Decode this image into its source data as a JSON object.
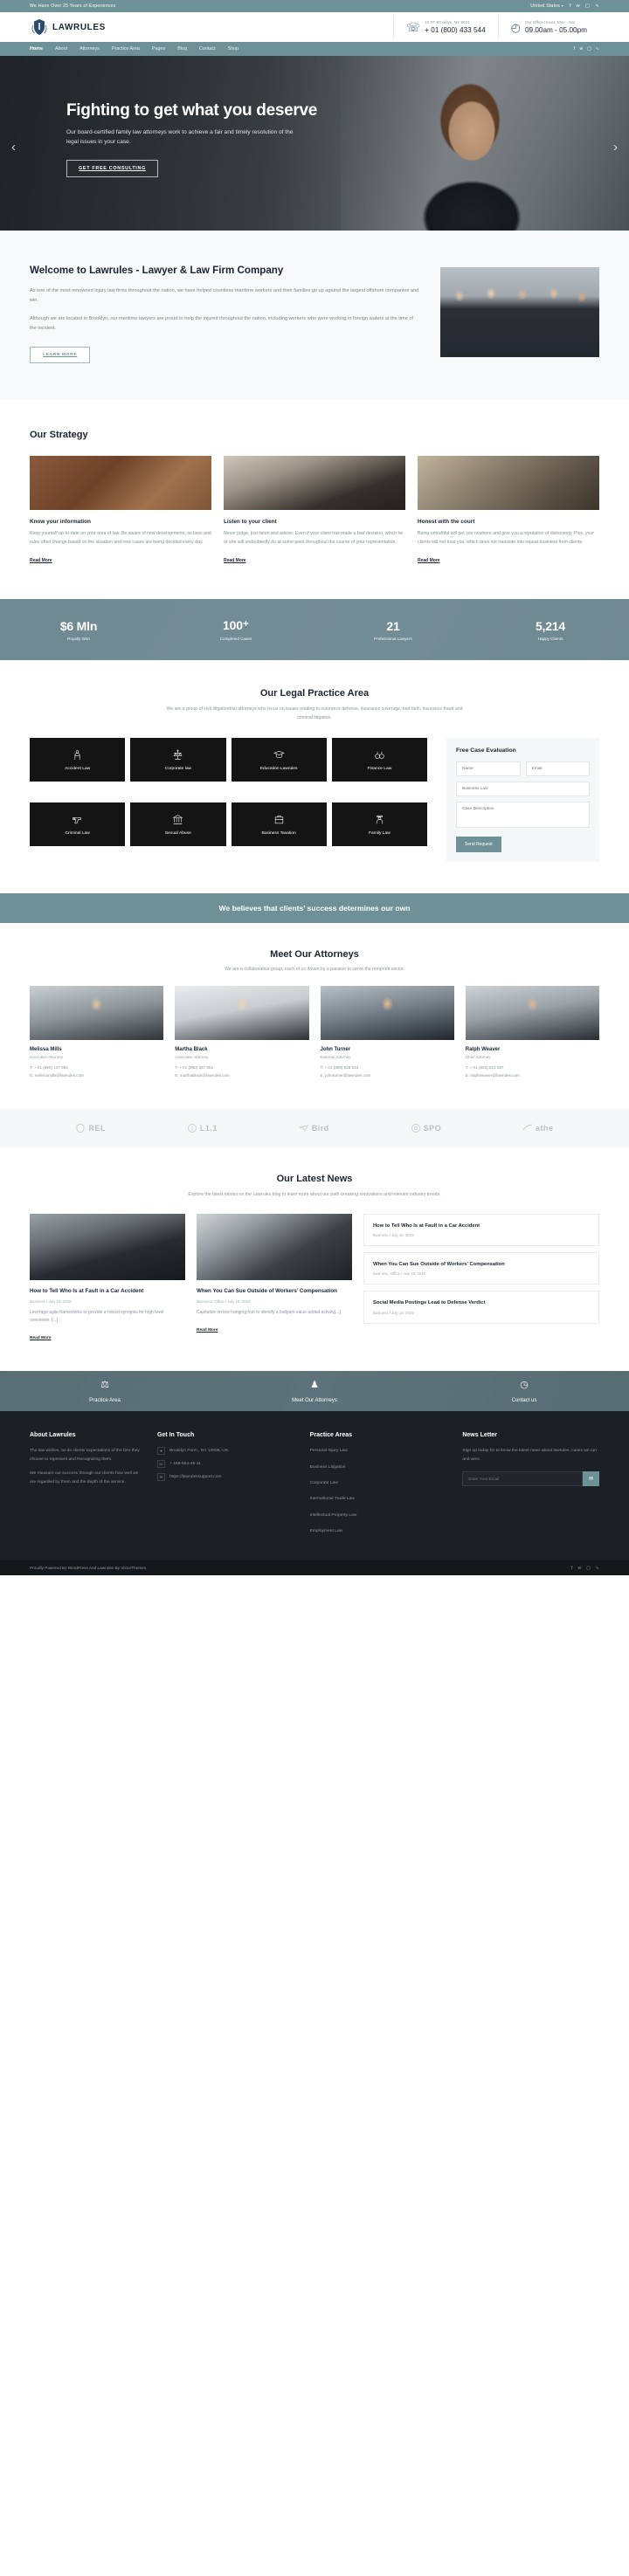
{
  "topbar": {
    "tagline": "We Have Over 25 Years of Experiences",
    "country": "United States",
    "socials": [
      "facebook-icon",
      "twitter-icon",
      "instagram-icon",
      "rss-icon"
    ]
  },
  "header": {
    "brand": "LAWRULES",
    "contact": {
      "label": "10 FF Brooklyn, NY 8021",
      "value": "+ 01 (800) 433 544"
    },
    "hours": {
      "label": "Our Office Hours: Mon - Sat",
      "value": "09.00am - 05.00pm"
    }
  },
  "nav": {
    "items": [
      {
        "label": "Home",
        "active": true
      },
      {
        "label": "About",
        "active": false
      },
      {
        "label": "Attorneys",
        "active": false
      },
      {
        "label": "Practice Area",
        "active": false
      },
      {
        "label": "Pages",
        "active": false
      },
      {
        "label": "Blog",
        "active": false
      },
      {
        "label": "Contact",
        "active": false
      },
      {
        "label": "Shop",
        "active": false
      }
    ]
  },
  "hero": {
    "title": "Fighting to get what you deserve",
    "subtitle": "Our board-certified family law attorneys work to achieve a fair and timely resolution of the legal issues in your case.",
    "cta": "GET FREE CONSULTING",
    "prev": "‹",
    "next": "›"
  },
  "welcome": {
    "title": "Welcome to Lawrules - Lawyer & Law Firm Company",
    "p1": "As one of the most renowned injury law firms throughout the nation, we have helped countless maritime workers and their families go up against the largest offshore companies and win.",
    "p2": "Although we are located in Brooklyn, our maritime lawyers are proud to help the injured throughout the nation, including workers who were working in foreign waters at the time of the incident.",
    "cta": "LEARN MORE"
  },
  "strategy": {
    "title": "Our Strategy",
    "cards": [
      {
        "title": "Know your information",
        "body": "Keep yourself up-to-date on your area of law. Be aware of new developments, as laws and rules often change based on the situation and new cases are being decided every day.",
        "link": "Read More"
      },
      {
        "title": "Listen to your client",
        "body": "Never judge, just listen and advise. Even if your client has made a bad decision, which he or she will undoubtedly do at some point throughout the course of your representation.",
        "link": "Read More"
      },
      {
        "title": "Honest with the court",
        "body": "Being untruthful will get you nowhere and give you a reputation of dishonesty. Plus, your clients will not trust you, which does not translate into repeat business from clients.",
        "link": "Read More"
      }
    ]
  },
  "counters": [
    {
      "value": "$6 Mln",
      "label": "Royalty Won"
    },
    {
      "value": "100⁺",
      "label": "Completed Cases"
    },
    {
      "value": "21",
      "label": "Professional Lawyers"
    },
    {
      "value": "5,214",
      "label": "Happy Clients"
    }
  ],
  "practice": {
    "title": "Our Legal Practice Area",
    "subtitle": "We are a group of civil litigationtrial attorneys who focus on issues relating to insurance defense, insurance coverage, bad faith, insurance fraud and criminal litigation.",
    "tiles": [
      {
        "label": "Accident Law",
        "icon": "injured-person-icon"
      },
      {
        "label": "Corporate law",
        "icon": "scales-icon"
      },
      {
        "label": "Education Lawrules",
        "icon": "graduation-cap-icon"
      },
      {
        "label": "Finance Law",
        "icon": "handcuffs-icon"
      },
      {
        "label": "Criminal Law",
        "icon": "gun-icon"
      },
      {
        "label": "Sexual Abuse",
        "icon": "courthouse-icon"
      },
      {
        "label": "Business Taxation",
        "icon": "briefcase-icon"
      },
      {
        "label": "Family Law",
        "icon": "police-officer-icon"
      }
    ],
    "form": {
      "title": "Free Case Evaluation",
      "name_placeholder": "Name",
      "email_placeholder": "Email",
      "subject_placeholder": "Business Law",
      "description_placeholder": "Case Description",
      "submit": "Send Request"
    }
  },
  "banner": {
    "text": "We believes that clients’ success determines our own"
  },
  "attorneys": {
    "title": "Meet Our Attorneys",
    "subtitle": "We are a collaborative group, each of us driven by a passion to serve the nonprofit sector.",
    "members": [
      {
        "name": "Melissa Mills",
        "role": "Executive Attorney",
        "phone": "T: + 01 (890) 147 856",
        "email": "E: melissamills@lawrules.com"
      },
      {
        "name": "Martha Black",
        "role": "Associate Attorney",
        "phone": "T: + 01 (890) 357 951",
        "email": "E: marthaBlack@lawrules.com"
      },
      {
        "name": "John Turner",
        "role": "External Attorney",
        "phone": "T: + 01 (899) 528 634",
        "email": "E: johnturner@lawrules.com"
      },
      {
        "name": "Ralph Weaver",
        "role": "Chief Attorney",
        "phone": "T: + 01 (800) 521 587",
        "email": "E: ralphweaver@lawrules.com"
      }
    ]
  },
  "logos": [
    "REL",
    "L1.1",
    "Bird",
    "SPO",
    "athe"
  ],
  "news": {
    "title": "Our Latest News",
    "subtitle": "Explore the latest stories on the Lawrules blog to learn more about our path-breaking innovations and relevant industry trends.",
    "cards": [
      {
        "title": "How to Tell Who Is at Fault in a Car Accident",
        "meta": "Business / July 19, 2019",
        "excerpt": "Leverage agile frameworks to provide a robust synopsis for high level overviews. [...]",
        "link": "Read More"
      },
      {
        "title": "When You Can Sue Outside of Workers’ Compensation",
        "meta": "Business, Office / July 19, 2019",
        "excerpt": "Capitalize on low hanging fruit to identify a ballpark value added activity[...]",
        "link": "Read More"
      }
    ],
    "list": [
      {
        "title": "How to Tell Who Is at Fault in a Car Accident",
        "meta": "Business / July 19, 2019"
      },
      {
        "title": "When You Can Sue Outside of Workers’ Compensation",
        "meta": "Business, Office / July 19, 2019"
      },
      {
        "title": "Social Media Postings Lead to Defense Verdict",
        "meta": "Business / July 19, 2019"
      }
    ]
  },
  "cta_strip": [
    {
      "label": "Practice Area",
      "icon": "scales-icon"
    },
    {
      "label": "Meet Our Attorneys",
      "icon": "people-icon"
    },
    {
      "label": "Contact us",
      "icon": "clock-icon"
    }
  ],
  "footer": {
    "about": {
      "title": "About Lawrules",
      "p1": "The law wishes, as do clients expectations of the firm they choose to represent and Recognizing them.",
      "p2": "We measure our success through our clients how well we are regarded by them and the depth of the service."
    },
    "touch": {
      "title": "Get In Touch",
      "items": [
        {
          "icon": "location-icon",
          "text": "Brooklyn Form , NY 10006, US"
        },
        {
          "icon": "phone-icon",
          "text": "+ 158-554-45-11"
        },
        {
          "icon": "mail-icon",
          "text": "https://lawrulessupport.com"
        }
      ]
    },
    "practice": {
      "title": "Practice Areas",
      "items": [
        "Personal Injury Law",
        "Business Litigation",
        "Corporate Law",
        "International Trade Law",
        "Intellectual Property Law",
        "Employment Law"
      ]
    },
    "newsletter": {
      "title": "News Letter",
      "text": "Sign up today for to know the latest news about lawrules, cases we run and wins.",
      "placeholder": "Enter Your Email",
      "button": "✉"
    }
  },
  "bottom": {
    "copyright": "Proudly Powered By WordPress And Lawrules By VictorThemes.",
    "socials": [
      "facebook-icon",
      "twitter-icon",
      "instagram-icon",
      "rss-icon"
    ]
  }
}
